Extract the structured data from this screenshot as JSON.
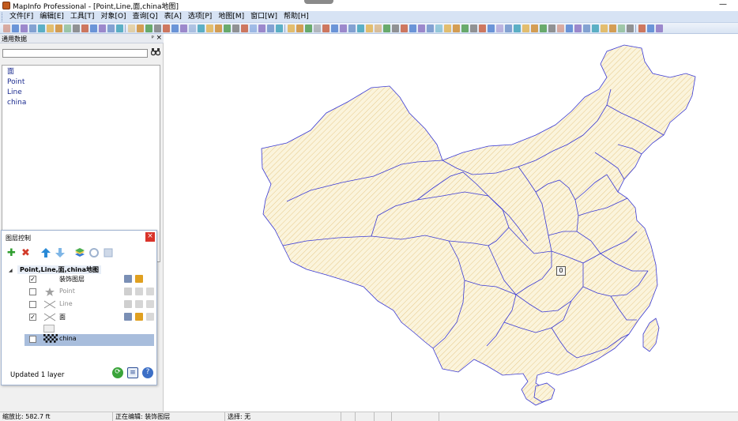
{
  "window": {
    "title": "MapInfo Professional - [Point,Line,面,china地图]",
    "minimize_glyph": "—"
  },
  "menu": [
    {
      "label": "文件[F]"
    },
    {
      "label": "编辑[E]"
    },
    {
      "label": "工具[T]"
    },
    {
      "label": "对象[O]"
    },
    {
      "label": "查询[Q]"
    },
    {
      "label": "表[A]"
    },
    {
      "label": "选项[P]"
    },
    {
      "label": "地图[M]"
    },
    {
      "label": "窗口[W]"
    },
    {
      "label": "帮助[H]"
    }
  ],
  "dock": {
    "title": "通用数据",
    "pin_glyph": "ᵖ",
    "close_glyph": "×",
    "search": {
      "value": "",
      "placeholder": ""
    },
    "search_button_icon": "binoculars-icon",
    "items": [
      {
        "label": "面"
      },
      {
        "label": "Point"
      },
      {
        "label": "Line"
      },
      {
        "label": "china"
      }
    ]
  },
  "layer_control": {
    "title": "图层控制",
    "close_glyph": "×",
    "map_name": "Point,Line,面,china地图",
    "status": "Updated 1 layer",
    "layers": [
      {
        "name": "装饰图层",
        "checked": true,
        "dim": false,
        "selected": false
      },
      {
        "name": "Point",
        "checked": false,
        "dim": true,
        "selected": false
      },
      {
        "name": "Line",
        "checked": false,
        "dim": true,
        "selected": false
      },
      {
        "name": "面",
        "checked": true,
        "dim": false,
        "selected": false
      },
      {
        "name": "china",
        "checked": false,
        "dim": false,
        "selected": true
      }
    ],
    "colors": {
      "add": "#2f9e2f",
      "remove": "#d23b2b",
      "selected_row": "#a8bddc"
    }
  },
  "map": {
    "label_value": "0",
    "region_fill": "#fbf4dc",
    "region_stroke": "#3a3ad6",
    "hatch": "#e6c98a"
  },
  "status": {
    "scale": "缩放比: 582.7 ft",
    "editing": "正在编辑: 装饰图层",
    "selection": "选择: 无"
  }
}
